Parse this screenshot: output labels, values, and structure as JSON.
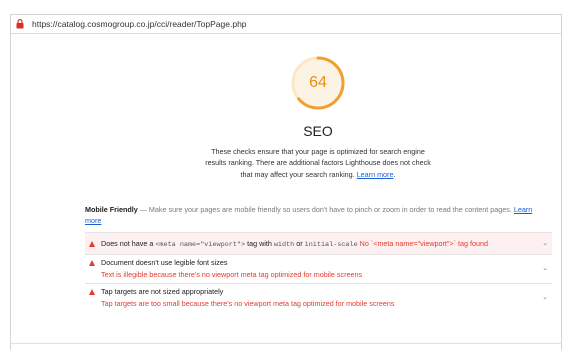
{
  "browser": {
    "url": "https://catalog.cosmogroup.co.jp/cci/reader/TopPage.php",
    "security_icon": "lock-icon"
  },
  "category": {
    "score": "64",
    "score_fraction": 0.64,
    "title": "SEO",
    "description": "These checks ensure that your page is optimized for search engine results ranking. There are additional factors Lighthouse does not check that may affect your search ranking.",
    "learn_more": "Learn more",
    "color": "#f0a030"
  },
  "group": {
    "title": "Mobile Friendly",
    "separator": " — ",
    "description": "Make sure your pages are mobile friendly so users don't have to pinch or zoom in order to read the content pages.",
    "learn_more": "Learn more"
  },
  "audits": [
    {
      "pre": "Does not have a ",
      "code1": "<meta name=\"viewport\">",
      "mid": " tag with ",
      "code2": "width",
      "or": " or ",
      "code3": "initial-scale",
      "warning": " No `<meta name=\"viewport\">` tag found",
      "icon": "fail-triangle-icon"
    },
    {
      "title": "Document doesn't use legible font sizes",
      "subtitle": "Text is illegible because there's no viewport meta tag optimized for mobile screens",
      "icon": "fail-triangle-icon"
    },
    {
      "title": "Tap targets are not sized appropriately",
      "subtitle": "Tap targets are too small because there's no viewport meta tag optimized for mobile screens",
      "icon": "fail-triangle-icon"
    }
  ],
  "expand_icon": "chevron-down-icon"
}
